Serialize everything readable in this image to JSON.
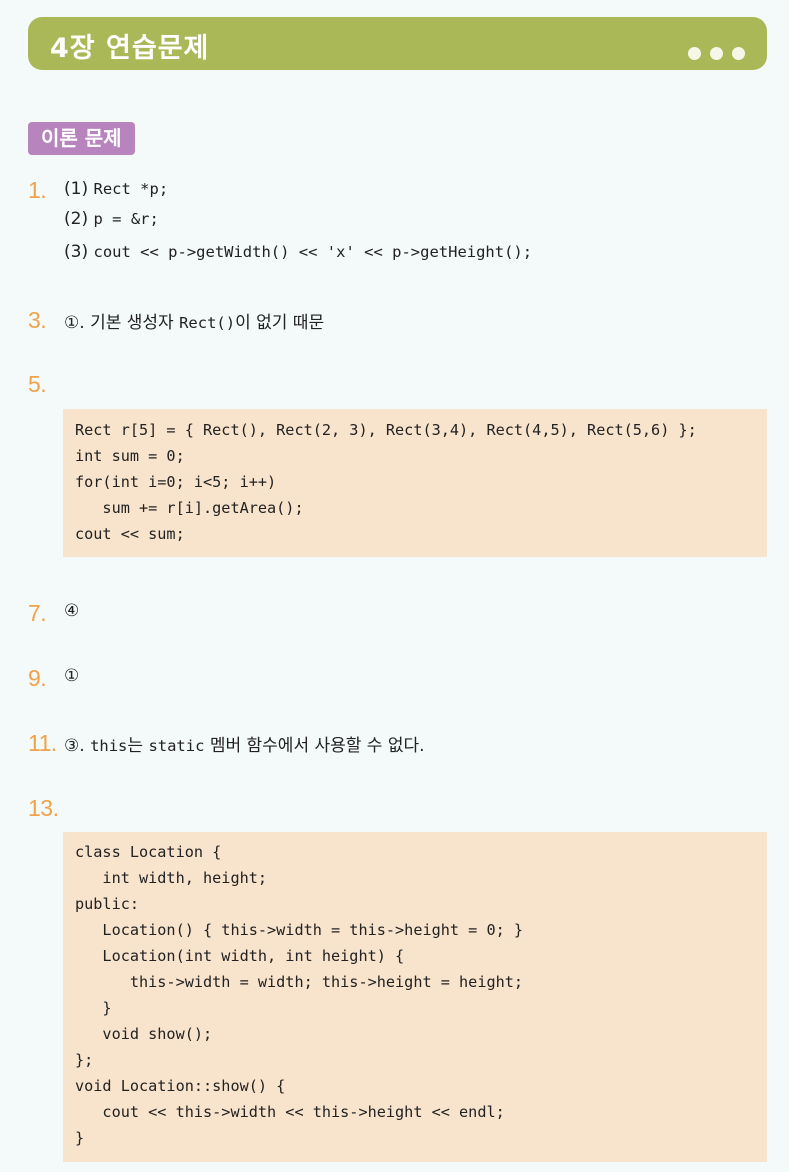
{
  "header": {
    "title": "4장 연습문제"
  },
  "section_badge": "이론 문제",
  "q1": {
    "number": "1.",
    "lines": [
      {
        "marker": "(1)",
        "code": "Rect *p;"
      },
      {
        "marker": "(2)",
        "code": "p = &r;"
      },
      {
        "marker": "(3)",
        "code": "cout << p->getWidth() << 'x' << p->getHeight();"
      }
    ]
  },
  "q3": {
    "number": "3.",
    "marker": "①.",
    "text1": "기본 생성자 ",
    "code": "Rect()",
    "text2": "이 없기 때문"
  },
  "q5": {
    "number": "5.",
    "code": [
      "Rect r[5] = { Rect(), Rect(2, 3), Rect(3,4), Rect(4,5), Rect(5,6) };",
      "int sum = 0;",
      "for(int i=0; i<5; i++)",
      "   sum += r[i].getArea();",
      "cout << sum;"
    ]
  },
  "q7": {
    "number": "7.",
    "answer": "④"
  },
  "q9": {
    "number": "9.",
    "answer": "①"
  },
  "q11": {
    "number": "11.",
    "marker": "③.",
    "code1": "this",
    "text1": "는 ",
    "code2": "static",
    "text2": " 멤버 함수에서 사용할 수 없다."
  },
  "q13": {
    "number": "13.",
    "code": [
      "class Location {",
      "   int width, height;",
      "public:",
      "   Location() { this->width = this->height = 0; }",
      "   Location(int width, int height) {",
      "      this->width = width; this->height = height;",
      "   }",
      "   void show();",
      "};",
      "void Location::show() {",
      "   cout << this->width << this->height << endl;",
      "}"
    ]
  }
}
